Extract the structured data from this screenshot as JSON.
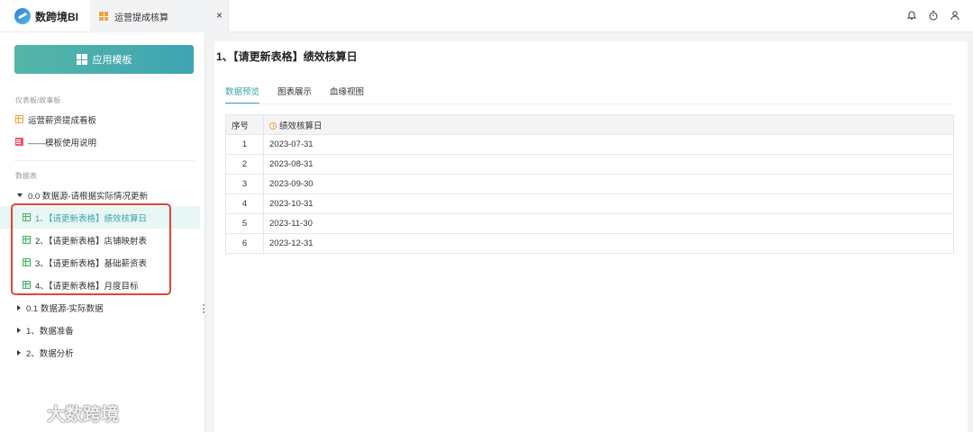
{
  "app": {
    "name": "数跨境BI"
  },
  "tab": {
    "label": "运营提成核算",
    "close": "×"
  },
  "sidebar": {
    "apply_button": "应用模板",
    "section_dashboards": "仪表板/故事板",
    "dashboards": [
      {
        "label": "运营薪资提成看板",
        "icon": "dashboard-icon"
      },
      {
        "label": "——模板使用说明",
        "icon": "document-icon"
      }
    ],
    "section_tables": "数据表",
    "folders": [
      {
        "label": "0.0 数据源-请根据实际情况更新",
        "expanded": true
      },
      {
        "label": "0.1 数据源-实际数据",
        "expanded": false
      },
      {
        "label": "1、数据准备",
        "expanded": false
      },
      {
        "label": "2、数据分析",
        "expanded": false
      }
    ],
    "tables": [
      {
        "label": "1、【请更新表格】绩效核算日",
        "active": true
      },
      {
        "label": "2、【请更新表格】店铺映射表",
        "active": false
      },
      {
        "label": "3、【请更新表格】基础薪资表",
        "active": false
      },
      {
        "label": "4、【请更新表格】月度目标",
        "active": false
      }
    ]
  },
  "main": {
    "title": "1、【请更新表格】绩效核算日",
    "tabs": [
      "数据预览",
      "图表展示",
      "血缘视图"
    ],
    "active_tab": "数据预览",
    "table": {
      "headers": [
        "序号",
        "绩效核算日"
      ],
      "rows": [
        [
          "1",
          "2023-07-31"
        ],
        [
          "2",
          "2023-08-31"
        ],
        [
          "3",
          "2023-09-30"
        ],
        [
          "4",
          "2023-10-31"
        ],
        [
          "5",
          "2023-11-30"
        ],
        [
          "6",
          "2023-12-31"
        ]
      ]
    }
  },
  "watermark": "大数跨境",
  "colors": {
    "accent": "#3fa4a8",
    "highlight_border": "#e0443a",
    "button": "#4fb0a8"
  }
}
